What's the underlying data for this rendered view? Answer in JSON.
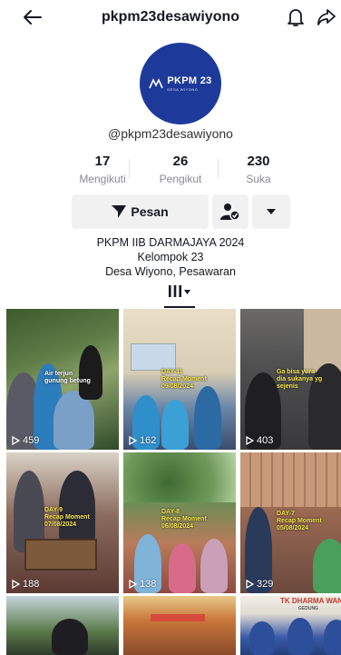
{
  "header": {
    "username": "pkpm23desawiyono",
    "back_icon": "arrow-left-icon",
    "notification_icon": "bell-icon",
    "share_icon": "share-icon"
  },
  "profile": {
    "avatar_brand": "PKPM 23",
    "avatar_sub": "DESA WIYONO",
    "handle": "@pkpm23desawiyono",
    "avatar_color": "#1d3a9a"
  },
  "stats": [
    {
      "value": "17",
      "label": "Mengikuti"
    },
    {
      "value": "26",
      "label": "Pengikut"
    },
    {
      "value": "230",
      "label": "Suka"
    }
  ],
  "actions": {
    "message_label": "Pesan",
    "message_icon": "send-icon",
    "follow_icon": "user-check-icon",
    "more_icon": "caret-down-icon"
  },
  "bio": {
    "line1": "PKPM IIB DARMAJAYA 2024",
    "line2": "Kelompok 23",
    "line3": "Desa Wiyono, Pesawaran"
  },
  "tabs": {
    "videos_icon": "grid-columns-icon"
  },
  "videos": [
    {
      "views": "459",
      "caption1": "Air terjun",
      "caption2": "gunung betung"
    },
    {
      "views": "162",
      "caption1": "DAY-11",
      "caption2": "Recap Moment",
      "caption3": "09/08/2024"
    },
    {
      "views": "403",
      "caption1": "Ga bisa yura",
      "caption2": "dia sukanya yg",
      "caption3": "sejenis"
    },
    {
      "views": "188",
      "caption1": "DAY-9",
      "caption2": "Recap Moment",
      "caption3": "07/08/2024"
    },
    {
      "views": "138",
      "caption1": "DAY-8",
      "caption2": "Recap Moment",
      "caption3": "06/08/2024"
    },
    {
      "views": "329",
      "caption1": "DAY-7",
      "caption2": "Recap Moment",
      "caption3": "05/08/2024"
    },
    {
      "views": ""
    },
    {
      "views": ""
    },
    {
      "views": "",
      "sign1": "TK DHARMA WAN",
      "sign2": "GEDUNG"
    }
  ]
}
